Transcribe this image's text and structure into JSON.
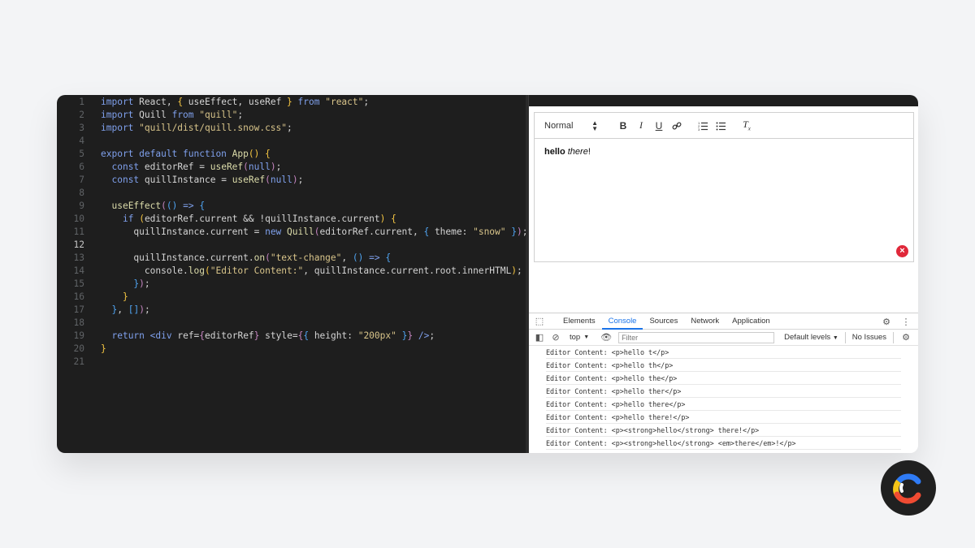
{
  "editor": {
    "lines": [
      {
        "n": "1",
        "tokens": [
          [
            "kw",
            "import"
          ],
          [
            "id",
            " React, "
          ],
          [
            "br1",
            "{"
          ],
          [
            "id",
            " useEffect, useRef "
          ],
          [
            "br1",
            "}"
          ],
          [
            "kw",
            " from"
          ],
          [
            "str",
            " \"react\""
          ],
          [
            "id",
            ";"
          ]
        ]
      },
      {
        "n": "2",
        "tokens": [
          [
            "kw",
            "import"
          ],
          [
            "id",
            " Quill "
          ],
          [
            "kw",
            "from"
          ],
          [
            "str",
            " \"quill\""
          ],
          [
            "id",
            ";"
          ]
        ]
      },
      {
        "n": "3",
        "tokens": [
          [
            "kw",
            "import"
          ],
          [
            "str",
            " \"quill/dist/quill.snow.css\""
          ],
          [
            "id",
            ";"
          ]
        ]
      },
      {
        "n": "4",
        "tokens": []
      },
      {
        "n": "5",
        "tokens": [
          [
            "kw",
            "export default function"
          ],
          [
            "fn",
            " App"
          ],
          [
            "br1",
            "()"
          ],
          [
            "id",
            " "
          ],
          [
            "br1",
            "{"
          ]
        ]
      },
      {
        "n": "6",
        "tokens": [
          [
            "id",
            "  "
          ],
          [
            "kw",
            "const"
          ],
          [
            "id",
            " editorRef = "
          ],
          [
            "fn",
            "useRef"
          ],
          [
            "br2",
            "("
          ],
          [
            "kw",
            "null"
          ],
          [
            "br2",
            ")"
          ],
          [
            "id",
            ";"
          ]
        ]
      },
      {
        "n": "7",
        "tokens": [
          [
            "id",
            "  "
          ],
          [
            "kw",
            "const"
          ],
          [
            "id",
            " quillInstance = "
          ],
          [
            "fn",
            "useRef"
          ],
          [
            "br2",
            "("
          ],
          [
            "kw",
            "null"
          ],
          [
            "br2",
            ")"
          ],
          [
            "id",
            ";"
          ]
        ]
      },
      {
        "n": "8",
        "tokens": []
      },
      {
        "n": "9",
        "tokens": [
          [
            "id",
            "  "
          ],
          [
            "fn",
            "useEffect"
          ],
          [
            "br2",
            "("
          ],
          [
            "br3",
            "()"
          ],
          [
            "kw",
            " =>"
          ],
          [
            "id",
            " "
          ],
          [
            "br3",
            "{"
          ]
        ]
      },
      {
        "n": "10",
        "tokens": [
          [
            "id",
            "    "
          ],
          [
            "kw",
            "if"
          ],
          [
            "id",
            " "
          ],
          [
            "br1",
            "("
          ],
          [
            "id",
            "editorRef.current && !quillInstance.current"
          ],
          [
            "br1",
            ")"
          ],
          [
            "id",
            " "
          ],
          [
            "br1",
            "{"
          ]
        ]
      },
      {
        "n": "11",
        "tokens": [
          [
            "id",
            "      quillInstance.current = "
          ],
          [
            "kw",
            "new"
          ],
          [
            "fn",
            " Quill"
          ],
          [
            "br2",
            "("
          ],
          [
            "id",
            "editorRef.current, "
          ],
          [
            "br3",
            "{"
          ],
          [
            "id",
            " theme: "
          ],
          [
            "str",
            "\"snow\""
          ],
          [
            "id",
            " "
          ],
          [
            "br3",
            "}"
          ],
          [
            "br2",
            ")"
          ],
          [
            "id",
            ";"
          ]
        ]
      },
      {
        "n": "12",
        "tokens": [],
        "active": true
      },
      {
        "n": "13",
        "tokens": [
          [
            "id",
            "      quillInstance.current."
          ],
          [
            "fn",
            "on"
          ],
          [
            "br2",
            "("
          ],
          [
            "str",
            "\"text-change\""
          ],
          [
            "id",
            ", "
          ],
          [
            "br3",
            "()"
          ],
          [
            "kw",
            " =>"
          ],
          [
            "id",
            " "
          ],
          [
            "br3",
            "{"
          ]
        ]
      },
      {
        "n": "14",
        "tokens": [
          [
            "id",
            "        console."
          ],
          [
            "fn",
            "log"
          ],
          [
            "br1",
            "("
          ],
          [
            "str",
            "\"Editor Content:\""
          ],
          [
            "id",
            ", quillInstance.current.root.innerHTML"
          ],
          [
            "br1",
            ")"
          ],
          [
            "id",
            ";"
          ]
        ]
      },
      {
        "n": "15",
        "tokens": [
          [
            "id",
            "      "
          ],
          [
            "br3",
            "}"
          ],
          [
            "br2",
            ")"
          ],
          [
            "id",
            ";"
          ]
        ]
      },
      {
        "n": "16",
        "tokens": [
          [
            "id",
            "    "
          ],
          [
            "br1",
            "}"
          ]
        ]
      },
      {
        "n": "17",
        "tokens": [
          [
            "id",
            "  "
          ],
          [
            "br3",
            "}"
          ],
          [
            "id",
            ", "
          ],
          [
            "br3",
            "[]"
          ],
          [
            "br2",
            ")"
          ],
          [
            "id",
            ";"
          ]
        ]
      },
      {
        "n": "18",
        "tokens": []
      },
      {
        "n": "19",
        "tokens": [
          [
            "id",
            "  "
          ],
          [
            "kw",
            "return"
          ],
          [
            "id",
            " "
          ],
          [
            "kw",
            "<div"
          ],
          [
            "id",
            " ref="
          ],
          [
            "br2",
            "{"
          ],
          [
            "id",
            "editorRef"
          ],
          [
            "br2",
            "}"
          ],
          [
            "id",
            " style="
          ],
          [
            "br2",
            "{"
          ],
          [
            "br3",
            "{"
          ],
          [
            "id",
            " height: "
          ],
          [
            "str",
            "\"200px\""
          ],
          [
            "id",
            " "
          ],
          [
            "br3",
            "}"
          ],
          [
            "br2",
            "}"
          ],
          [
            "kw",
            " />"
          ],
          [
            "id",
            ";"
          ]
        ]
      },
      {
        "n": "20",
        "tokens": [
          [
            "br1",
            "}"
          ]
        ]
      },
      {
        "n": "21",
        "tokens": []
      }
    ]
  },
  "quill": {
    "format_select": "Normal",
    "content_bold": "hello",
    "content_italic": "there",
    "content_tail": "!"
  },
  "devtools": {
    "tabs": [
      "Elements",
      "Console",
      "Sources",
      "Network",
      "Application"
    ],
    "active_tab": "Console",
    "context": "top",
    "filter_placeholder": "Filter",
    "levels": "Default levels",
    "issues": "No Issues",
    "logs": [
      "Editor Content: <p>hello t</p>",
      "Editor Content: <p>hello th</p>",
      "Editor Content: <p>hello the</p>",
      "Editor Content: <p>hello ther</p>",
      "Editor Content: <p>hello there</p>",
      "Editor Content: <p>hello there!</p>",
      "Editor Content: <p><strong>hello</strong> there!</p>",
      "Editor Content: <p><strong>hello</strong> <em>there</em>!</p>"
    ]
  },
  "colors": {
    "editor_bg": "#1e1e1e",
    "accent_blue": "#1a73e8",
    "error_red": "#e0283a"
  }
}
